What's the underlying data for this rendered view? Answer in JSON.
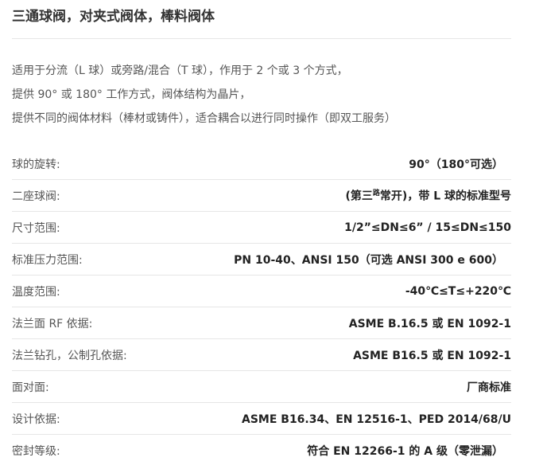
{
  "title": "三通球阀，对夹式阀体，棒料阀体",
  "intro": [
    "适用于分流（L 球）或旁路/混合（T 球），作用于 2 个或 3 个方式，",
    "提供 90° 或 180° 工作方式，阀体结构为晶片，",
    "提供不同的阀体材料（棒材或铸件），适合耦合以进行同时操作（即双工服务）"
  ],
  "specs": [
    {
      "label": "球的旋转:",
      "value": "90°（180°可选）"
    },
    {
      "label": "二座球阀:",
      "value_pre": "(第三",
      "value_sup": "路",
      "value_post": "常开)，带 L 球的标准型号"
    },
    {
      "label": "尺寸范围:",
      "value": "1/2”≤DN≤6” / 15≤DN≤150"
    },
    {
      "label": "标准压力范围:",
      "value": "PN 10-40、ANSI 150（可选 ANSI 300 e 600）"
    },
    {
      "label": "温度范围:",
      "value": "-40℃≤T≤+220℃"
    },
    {
      "label": "法兰面 RF 依据:",
      "value": "ASME B.16.5 或 EN 1092-1"
    },
    {
      "label": "法兰钻孔，公制孔依据:",
      "value": "ASME B16.5 或 EN 1092-1"
    },
    {
      "label": "面对面:",
      "value": "厂商标准"
    },
    {
      "label": "设计依据:",
      "value": "ASME B16.34、EN 12516-1、PED 2014/68/U"
    },
    {
      "label": "密封等级:",
      "value": "符合 EN 12266-1 的 A 级（零泄漏）"
    }
  ]
}
